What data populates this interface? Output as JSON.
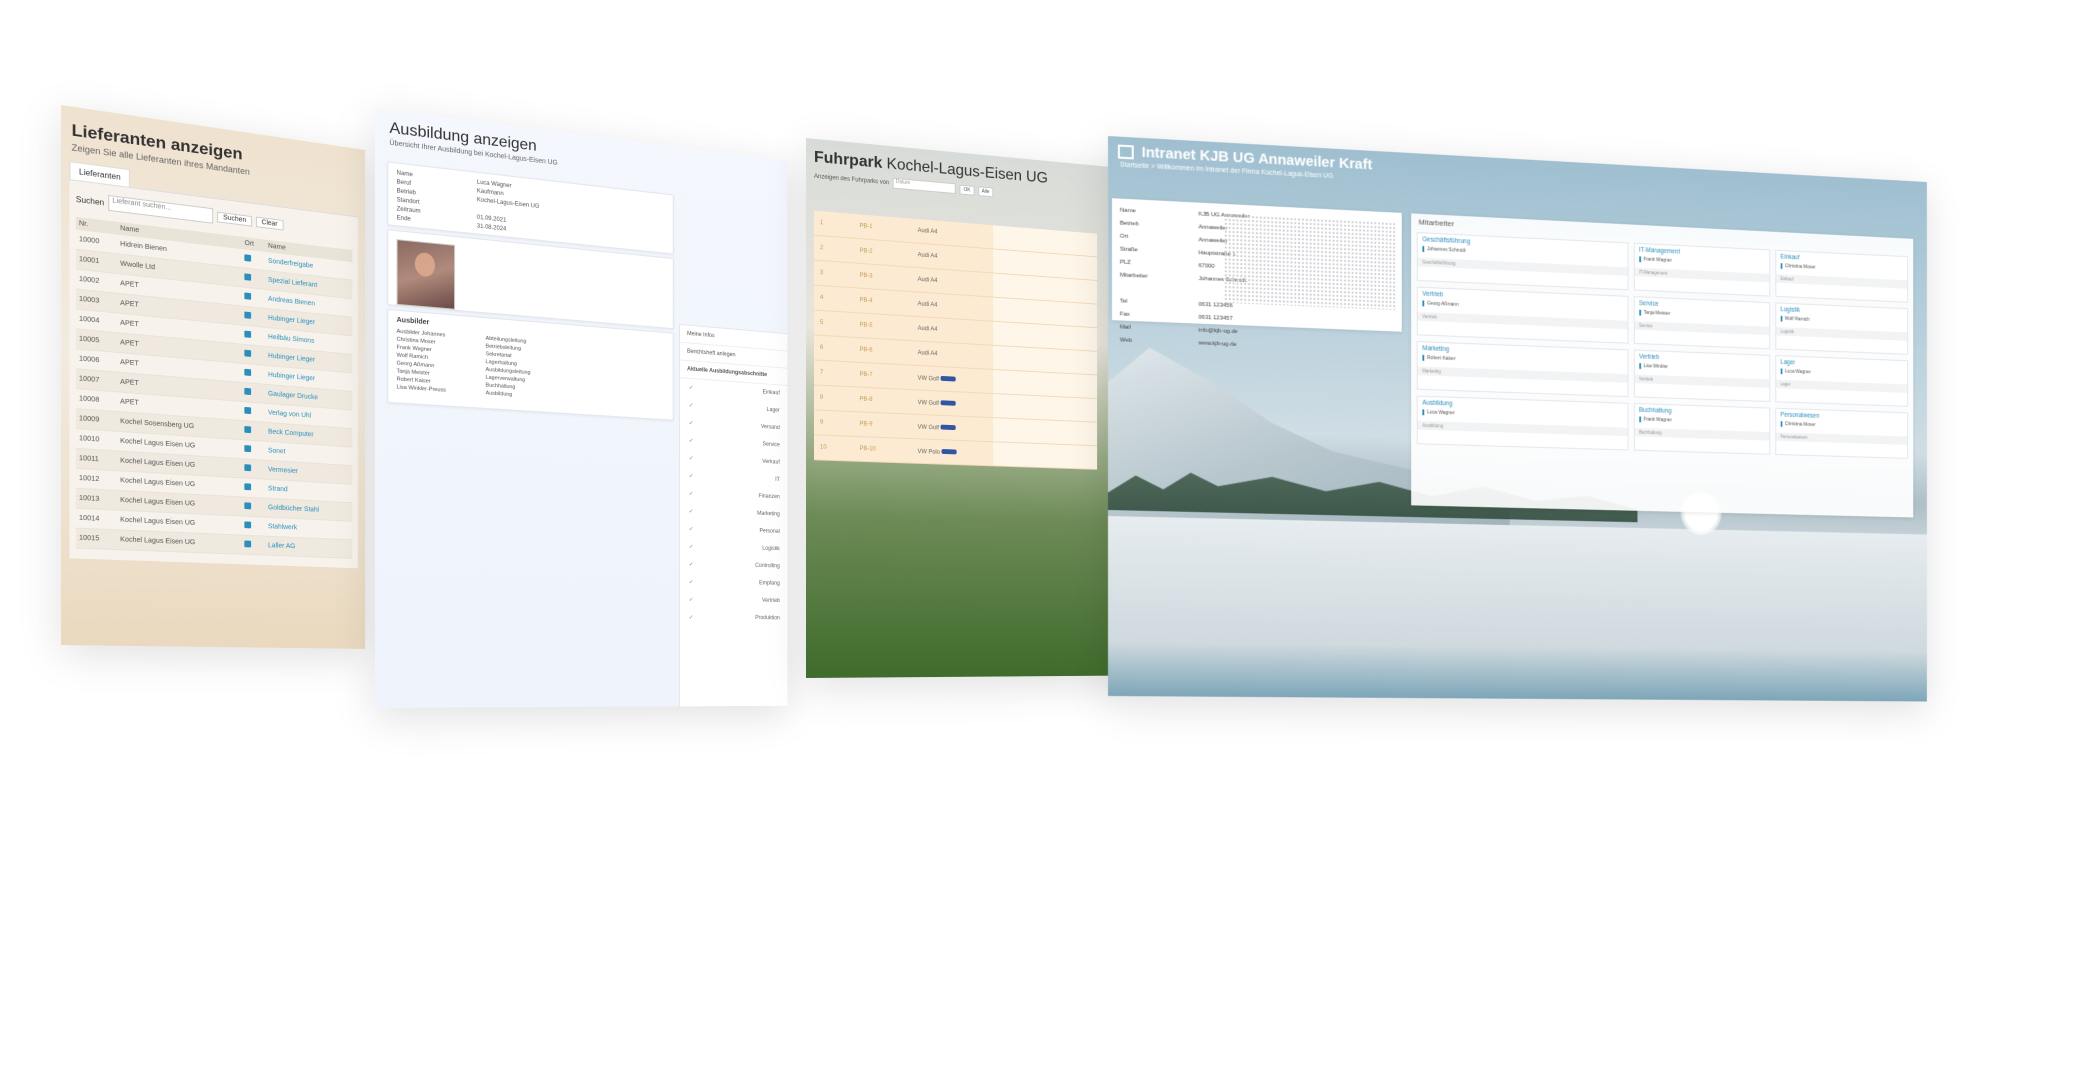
{
  "lieferanten": {
    "title": "Lieferanten anzeigen",
    "subtitle": "Zeigen Sie alle Lieferanten ihres Mandanten",
    "tab": "Lieferanten",
    "search_label": "Suchen",
    "search_placeholder": "Lieferant suchen...",
    "search_button": "Suchen",
    "clear_button": "Clear",
    "columns": [
      "Nr.",
      "Name",
      "Ort",
      "Name"
    ],
    "rows": [
      {
        "nr": "10000",
        "name": "Hidrein Bienen",
        "web": "Sonderfreigabe"
      },
      {
        "nr": "10001",
        "name": "Wwolle Ltd",
        "web": "Spezial Lieferant"
      },
      {
        "nr": "10002",
        "name": "APET",
        "web": "Andreas Bienen"
      },
      {
        "nr": "10003",
        "name": "APET",
        "web": "Hubinger Lieger"
      },
      {
        "nr": "10004",
        "name": "APET",
        "web": "Heilbäu Simons"
      },
      {
        "nr": "10005",
        "name": "APET",
        "web": "Hubinger Lieger"
      },
      {
        "nr": "10006",
        "name": "APET",
        "web": "Hubinger Lieger"
      },
      {
        "nr": "10007",
        "name": "APET",
        "web": "Gaulager Drucke"
      },
      {
        "nr": "10008",
        "name": "APET",
        "web": "Verlag von Uhl"
      },
      {
        "nr": "10009",
        "name": "Kochel Sosensberg UG",
        "web": "Beck Computer"
      },
      {
        "nr": "10010",
        "name": "Kochel Lagus Eisen UG",
        "web": "Sonet"
      },
      {
        "nr": "10011",
        "name": "Kochel Lagus Eisen UG",
        "web": "Vermesier"
      },
      {
        "nr": "10012",
        "name": "Kochel Lagus Eisen UG",
        "web": "Strand"
      },
      {
        "nr": "10013",
        "name": "Kochel Lagus Eisen UG",
        "web": "Goldbücher Stahl"
      },
      {
        "nr": "10014",
        "name": "Kochel Lagus Eisen UG",
        "web": "Stahlwerk"
      },
      {
        "nr": "10015",
        "name": "Kochel Lagus Eisen UG",
        "web": "Laller AG"
      }
    ]
  },
  "ausbildung": {
    "title": "Ausbildung anzeigen",
    "subtitle": "Übersicht Ihrer Ausbildung bei Kochel-Lagus-Eisen UG",
    "info": [
      {
        "k": "Name",
        "v": "Luca Wagner"
      },
      {
        "k": "Beruf",
        "v": "Kaufmann"
      },
      {
        "k": "Betrieb",
        "v": "Kochel-Lagus-Eisen UG"
      },
      {
        "k": "Standort",
        "v": ""
      },
      {
        "k": "Zeitraum",
        "v": "01.09.2021"
      },
      {
        "k": "Ende",
        "v": "31.08.2024"
      }
    ],
    "section_label": "Ausbilder",
    "left_col": [
      "Ausbilder Johannes",
      "Christina Moser",
      "Frank Wagner",
      "Wolf Ramich",
      "Georg Aßmann",
      "Tanja Meister",
      "Robert Kaiser",
      "Lisa Winkler-Preuss"
    ],
    "right_col": [
      "Abteilungsleitung",
      "Betriebsleitung",
      "Sekretariat",
      "Lagerhaltung",
      "Ausbildungsleitung",
      "Lagerverwaltung",
      "Buchhaltung",
      "Ausbildung"
    ],
    "side_items": [
      "Meine Infos",
      "Berichtsheft anlegen"
    ],
    "side_heading": "Aktuelle Ausbildungsabschnitte",
    "checks": [
      "Einkauf",
      "Lager",
      "Versand",
      "Service",
      "Verkauf",
      "IT",
      "Finanzen",
      "Marketing",
      "Personal",
      "Logistik",
      "Controlling",
      "Empfang",
      "Vertrieb",
      "Produktion"
    ]
  },
  "fuhrpark": {
    "title_bold": "Fuhrpark",
    "title_rest": "Kochel-Lagus-Eisen UG",
    "filter_label": "Anzeigen des Fuhrparks von",
    "filter_placeholder": "Datum",
    "btn1": "OK",
    "btn2": "Alle",
    "rows": [
      {
        "a": "1",
        "b": "PB-1",
        "c": "Audi A4"
      },
      {
        "a": "2",
        "b": "PB-2",
        "c": "Audi A4"
      },
      {
        "a": "3",
        "b": "PB-3",
        "c": "Audi A4"
      },
      {
        "a": "4",
        "b": "PB-4",
        "c": "Audi A4"
      },
      {
        "a": "5",
        "b": "PB-5",
        "c": "Audi A4"
      },
      {
        "a": "6",
        "b": "PB-6",
        "c": "Audi A4"
      },
      {
        "a": "7",
        "b": "PB-7",
        "c": "VW Golf"
      },
      {
        "a": "8",
        "b": "PB-8",
        "c": "VW Golf"
      },
      {
        "a": "9",
        "b": "PB-9",
        "c": "VW Golf"
      },
      {
        "a": "10",
        "b": "PB-10",
        "c": "VW Polo"
      }
    ]
  },
  "intranet": {
    "title": "Intranet KJB UG Annaweiler Kraft",
    "breadcrumb": "Startseite > Willkommen im Intranet der Firma Kochel-Lagus-Eisen UG",
    "info": [
      {
        "k": "Name",
        "v": "KJB UG Annaweiler"
      },
      {
        "k": "Betrieb",
        "v": "Annaweiler"
      },
      {
        "k": "Ort",
        "v": "Annaweiler"
      },
      {
        "k": "Straße",
        "v": "Hauptstraße 1"
      },
      {
        "k": "PLZ",
        "v": "67000"
      },
      {
        "k": "Mitarbeiter",
        "v": "Johannes Schmidt"
      },
      {
        "k": "",
        "v": ""
      },
      {
        "k": "Tel",
        "v": "0631 123456"
      },
      {
        "k": "Fax",
        "v": "0631 123457"
      },
      {
        "k": "Mail",
        "v": "info@kjb-ug.de"
      },
      {
        "k": "Web",
        "v": "www.kjb-ug.de"
      }
    ],
    "mit_label": "Mitarbeiter",
    "departments": [
      {
        "name": "Geschäftsführung",
        "person": "Johannes Schmidt",
        "foot": "Geschäftsführung"
      },
      {
        "name": "IT-Management",
        "person": "Frank Wagner",
        "foot": "IT-Management"
      },
      {
        "name": "Einkauf",
        "person": "Christina Moser",
        "foot": "Einkauf"
      },
      {
        "name": "Vertrieb",
        "person": "Georg Aßmann",
        "foot": "Vertrieb"
      },
      {
        "name": "Service",
        "person": "Tanja Meister",
        "foot": "Service"
      },
      {
        "name": "Logistik",
        "person": "Wolf Ramich",
        "foot": "Logistik"
      },
      {
        "name": "Marketing",
        "person": "Robert Kaiser",
        "foot": "Marketing"
      },
      {
        "name": "Vertrieb",
        "person": "Lisa Winkler",
        "foot": "Vertrieb"
      },
      {
        "name": "Lager",
        "person": "Luca Wagner",
        "foot": "Lager"
      },
      {
        "name": "Ausbildung",
        "person": "Luca Wagner",
        "foot": "Ausbildung"
      },
      {
        "name": "Buchhaltung",
        "person": "Frank Wagner",
        "foot": "Buchhaltung"
      },
      {
        "name": "Personalwesen",
        "person": "Christina Moser",
        "foot": "Personalwesen"
      }
    ]
  }
}
